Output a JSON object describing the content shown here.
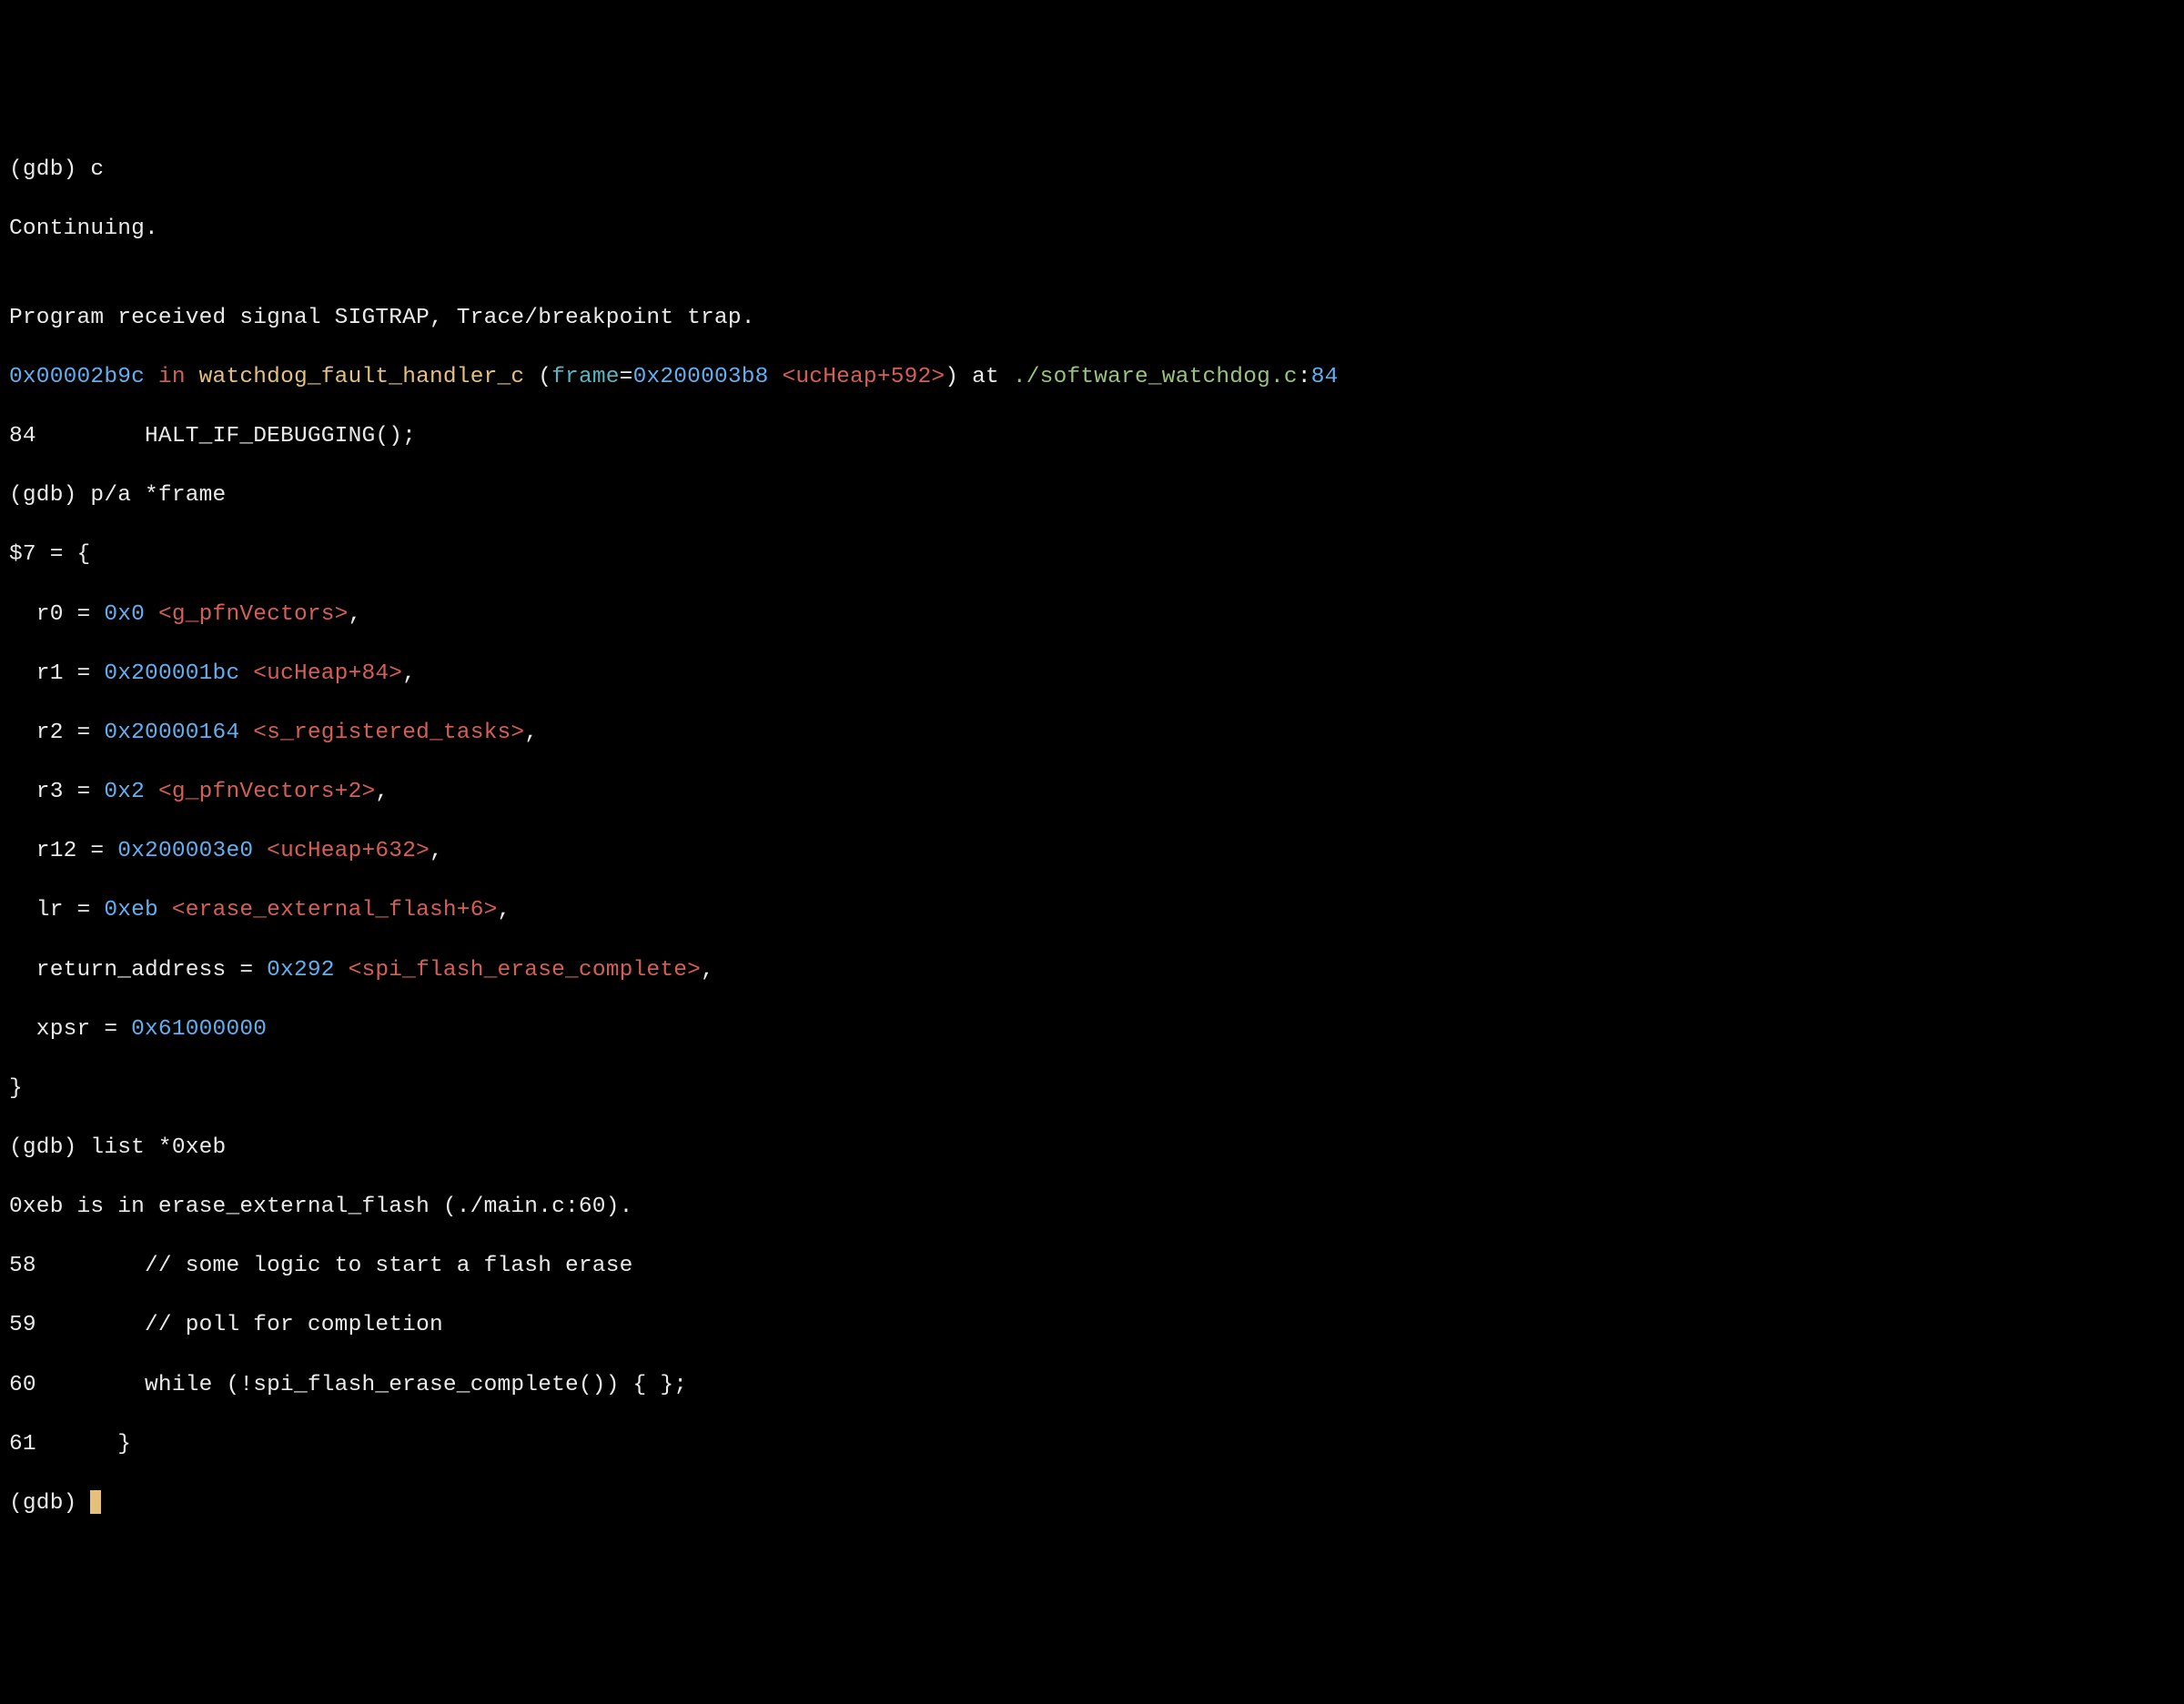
{
  "l1_prompt": "(gdb) ",
  "l1_cmd": "c",
  "l2": "Continuing.",
  "blank": "",
  "l4": "Program received signal SIGTRAP, Trace/breakpoint trap.",
  "l5_addr": "0x00002b9c",
  "l5_in": " in ",
  "l5_func": "watchdog_fault_handler_c",
  "l5_space": " ",
  "l5_lparen": "(",
  "l5_var": "frame",
  "l5_eq": "=",
  "l5_arg_hex": "0x200003b8",
  "l5_arg_sym": " <ucHeap+592>",
  "l5_rparen": ")",
  "l5_at": " at ",
  "l5_path": "./software_watchdog.c",
  "l5_colon": ":",
  "l5_line": "84",
  "l6_num": "84",
  "l6_text": "        HALT_IF_DEBUGGING();",
  "l7_prompt": "(gdb) ",
  "l7_cmd": "p/a *frame",
  "l8": "$7 = {",
  "r0_label": "  r0 = ",
  "r0_hex": "0x0",
  "r0_sym": " <g_pfnVectors>",
  "r0_tail": ",",
  "r1_label": "  r1 = ",
  "r1_hex": "0x200001bc",
  "r1_sym": " <ucHeap+84>",
  "r1_tail": ",",
  "r2_label": "  r2 = ",
  "r2_hex": "0x20000164",
  "r2_sym": " <s_registered_tasks>",
  "r2_tail": ",",
  "r3_label": "  r3 = ",
  "r3_hex": "0x2",
  "r3_sym": " <g_pfnVectors+2>",
  "r3_tail": ",",
  "r12_label": "  r12 = ",
  "r12_hex": "0x200003e0",
  "r12_sym": " <ucHeap+632>",
  "r12_tail": ",",
  "lr_label": "  lr = ",
  "lr_hex": "0xeb",
  "lr_sym": " <erase_external_flash+6>",
  "lr_tail": ",",
  "ra_label": "  return_address = ",
  "ra_hex": "0x292",
  "ra_sym": " <spi_flash_erase_complete>",
  "ra_tail": ",",
  "xpsr_label": "  xpsr = ",
  "xpsr_hex": "0x61000000",
  "close_brace": "}",
  "l19_prompt": "(gdb) ",
  "l19_cmd": "list *0xeb",
  "l20": "0xeb is in erase_external_flash (./main.c:60).",
  "src58_num": "58",
  "src58_txt": "        // some logic to start a flash erase",
  "src59_num": "59",
  "src59_txt": "        // poll for completion",
  "src60_num": "60",
  "src60_txt": "        while (!spi_flash_erase_complete()) { };",
  "src61_num": "61",
  "src61_txt": "      }",
  "l_last_prompt": "(gdb) "
}
